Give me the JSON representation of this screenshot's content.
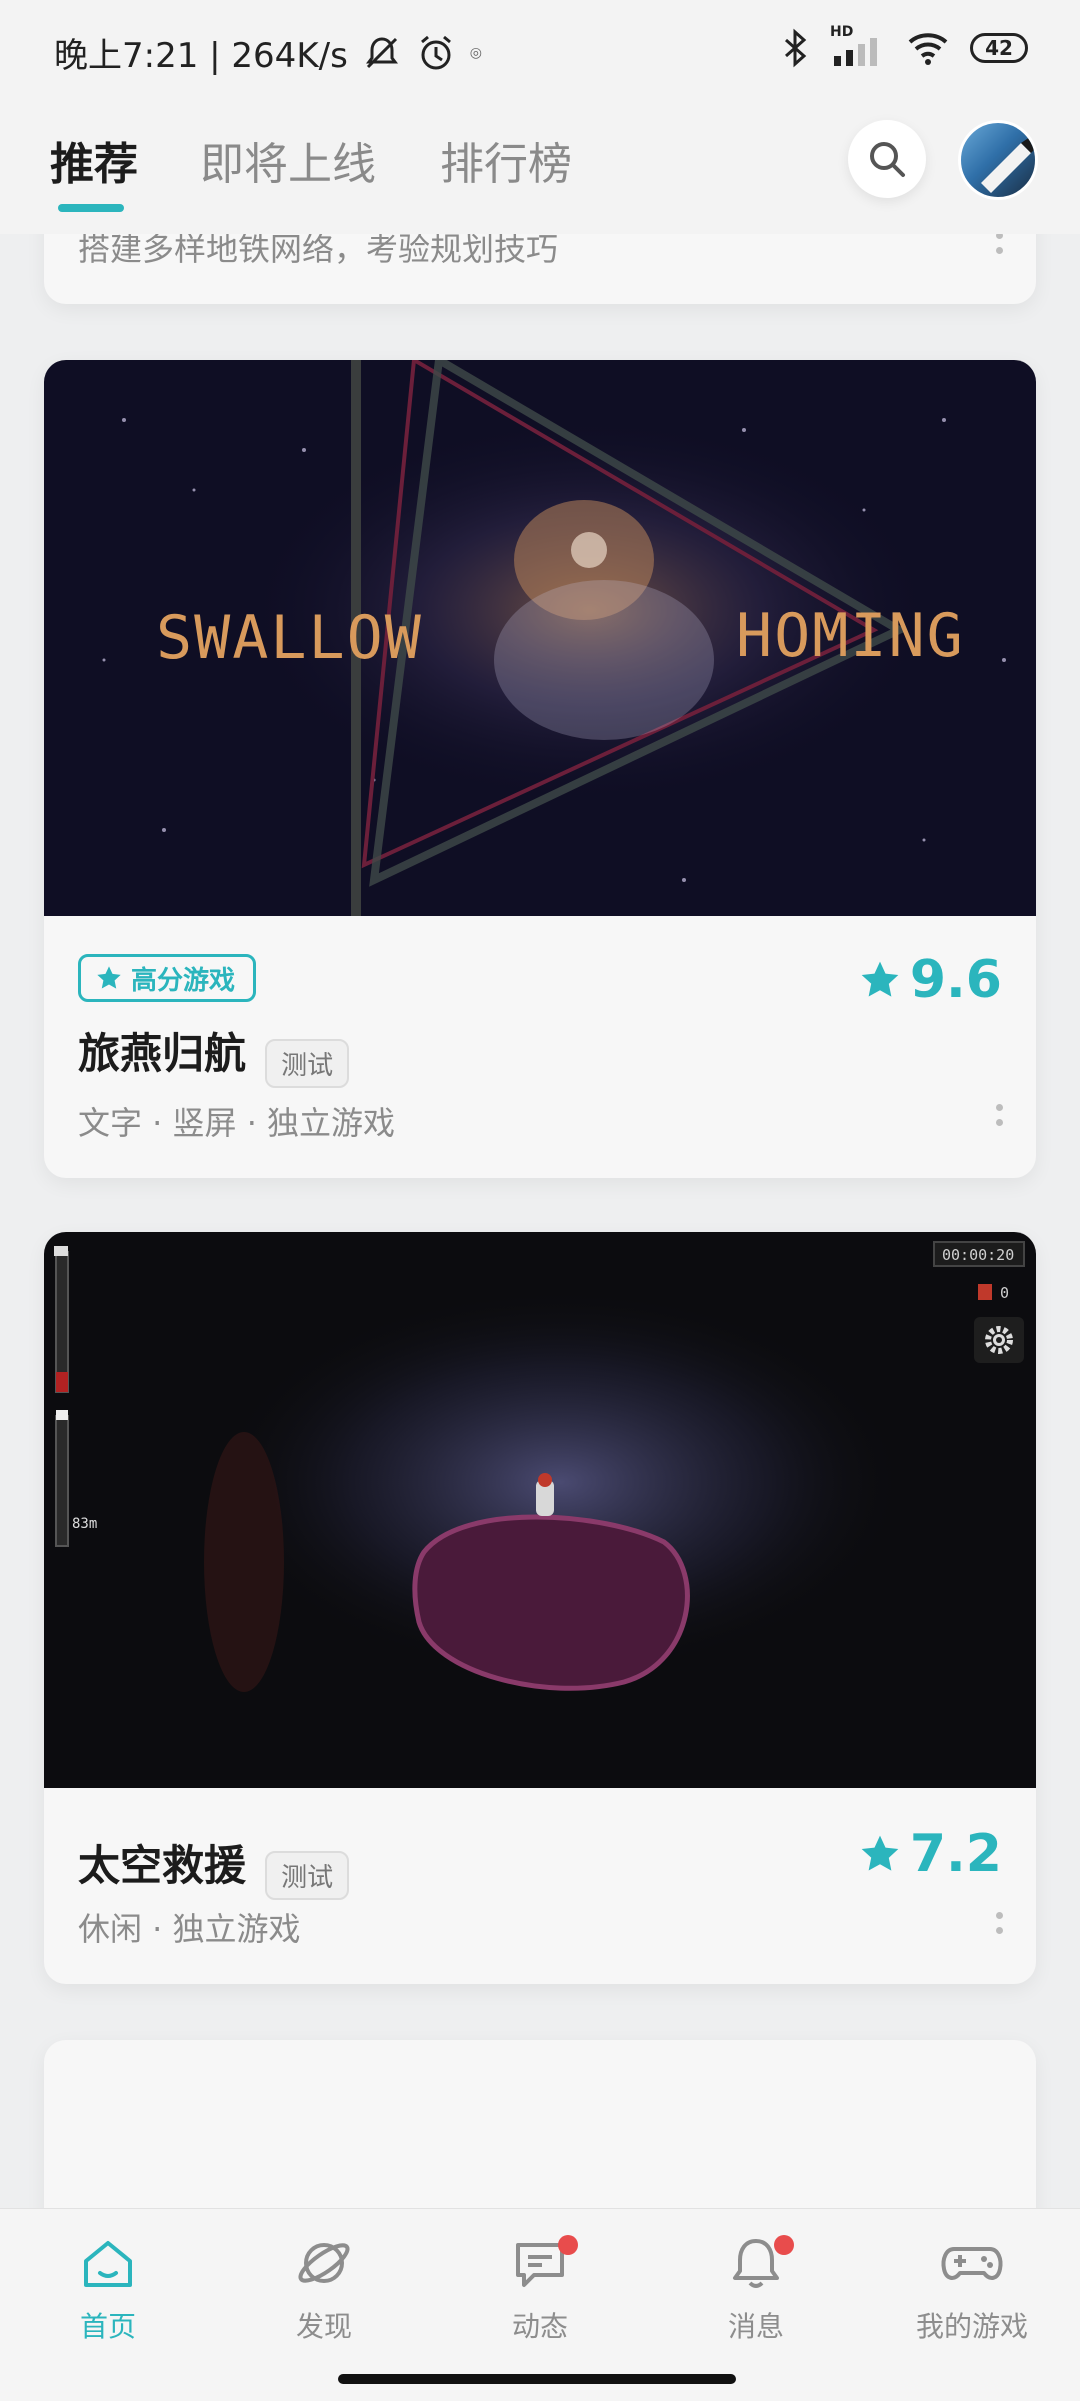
{
  "status_bar": {
    "time": "晚上7:21 | 264K/s",
    "battery": "42",
    "signal_label": "HD"
  },
  "header": {
    "tabs": [
      {
        "label": "推荐",
        "active": true
      },
      {
        "label": "即将上线",
        "active": false
      },
      {
        "label": "排行榜",
        "active": false
      }
    ],
    "search_icon": "search-icon",
    "accent_color": "#2bb5bd"
  },
  "prev_card": {
    "description": "搭建多样地铁网络，考验规划技巧"
  },
  "cards": [
    {
      "banner_text_left": "SWALLOW",
      "banner_text_right": "HOMING",
      "badge": "高分游戏",
      "title": "旅燕归航",
      "test_label": "测试",
      "rating": "9.6",
      "tags": "文字 · 竖屏 · 独立游戏"
    },
    {
      "hud_timer": "00:00:20",
      "hud_count": "0",
      "hud_distance": "83m",
      "title": "太空救援",
      "test_label": "测试",
      "rating": "7.2",
      "tags": "休闲 · 独立游戏"
    }
  ],
  "bottom_nav": [
    {
      "label": "首页",
      "icon": "home-icon",
      "active": true,
      "badge": false
    },
    {
      "label": "发现",
      "icon": "planet-icon",
      "active": false,
      "badge": false
    },
    {
      "label": "动态",
      "icon": "chat-icon",
      "active": false,
      "badge": true
    },
    {
      "label": "消息",
      "icon": "bell-icon",
      "active": false,
      "badge": true
    },
    {
      "label": "我的游戏",
      "icon": "gamepad-icon",
      "active": false,
      "badge": false
    }
  ]
}
